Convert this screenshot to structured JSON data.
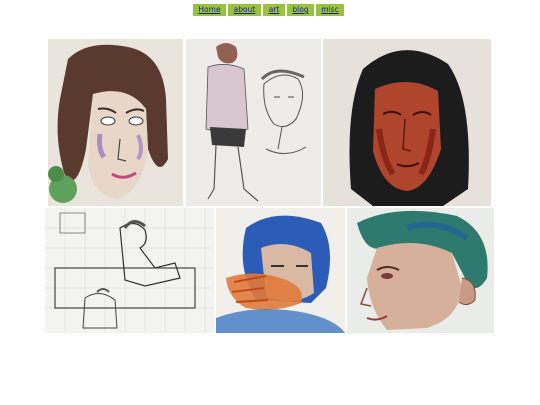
{
  "nav": {
    "items": [
      {
        "label": "Home"
      },
      {
        "label": "about"
      },
      {
        "label": "art"
      },
      {
        "label": "blog"
      },
      {
        "label": "misc"
      }
    ]
  },
  "gallery": {
    "images": [
      {
        "subject": "portrait sketch of a person with dark hair, purple and pink marker shading"
      },
      {
        "subject": "pencil sketch of a figure in a sweater and shorts beside a drawn face"
      },
      {
        "subject": "painted portrait with long dark hair and red-brown face"
      },
      {
        "subject": "pencil sketch on grid paper of a person sitting on a couch"
      },
      {
        "subject": "watercolor of a person with blue hair and hand over face"
      },
      {
        "subject": "watercolor portrait in profile with green-blue hair"
      }
    ]
  }
}
